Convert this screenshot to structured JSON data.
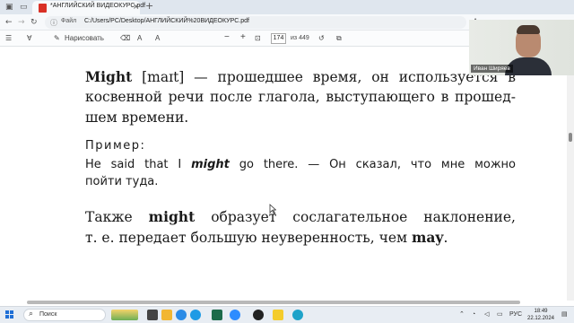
{
  "browser": {
    "tab_title": "*АНГЛИЙСКИЙ ВИДЕОКУРС.pdf",
    "tab_close": "×",
    "new_tab": "+",
    "file_label": "Файл",
    "url": "C:/Users/PC/Desktop/АНГЛИЙСКИЙ%20ВИДЕОКУРС.pdf"
  },
  "pdf_toolbar": {
    "draw_label": "Нарисовать",
    "page_current": "174",
    "page_total": "из 449",
    "zoom_minus": "−",
    "zoom_plus": "+"
  },
  "document": {
    "p1_line1_bold": "Might",
    "p1_line1_rest": " [maɪt] — прошедшее время, он используется в",
    "p1_line2": "косвенной речи после глагола, выступающего в прошед-",
    "p1_line3": "шем времени.",
    "example_label": "Пример:",
    "ex_line1_a": "He said that I ",
    "ex_line1_b": "might",
    "ex_line1_c": " go there. — Он сказал, что мне можно",
    "ex_line2": "пойти туда.",
    "p2_line1_a": "Также ",
    "p2_line1_b": "might",
    "p2_line1_c": " образует сослагательное наклонение,",
    "p2_line2_a": "т. е. передает большую неуверенность, чем ",
    "p2_line2_b": "may",
    "p2_line2_c": "."
  },
  "webcam": {
    "name": "Иван Ширяев"
  },
  "taskbar": {
    "search_label": "Поиск",
    "lang": "РУС",
    "time": "18:49",
    "date": "22.12.2024"
  },
  "colors": {
    "pdf_red": "#d93025",
    "accent": "#1f6fd6"
  }
}
